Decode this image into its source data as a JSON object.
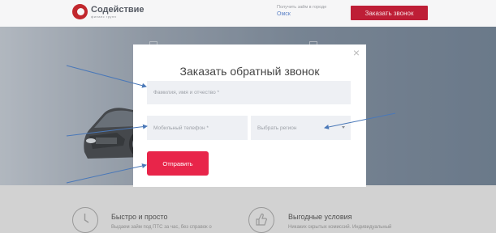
{
  "header": {
    "logo_name": "Содействие",
    "logo_sub": "финанс групп",
    "city_prompt": "Получить займ в городе",
    "city_name": "Омск",
    "callback_button": "Заказать звонок"
  },
  "features": [
    {
      "title": "Быстро и просто",
      "text": "Выдаем займ под ПТС за час, без справок о",
      "icon": "clock-icon"
    },
    {
      "title": "Выгодные условия",
      "text": "Никаких скрытых комиссий. Индивидуальный",
      "icon": "thumbs-up-icon"
    }
  ],
  "modal": {
    "title": "Заказать обратный звонок",
    "close_glyph": "×",
    "name_placeholder": "Фамилия, имя и отчество *",
    "phone_placeholder": "Мобильный телефон *",
    "region_placeholder": "Выбрать регион",
    "submit_label": "Отправить"
  },
  "colors": {
    "brand_red": "#be1e36",
    "submit_red": "#e8254a",
    "field_bg": "#eef0f4",
    "city_link": "#5b82c7",
    "annotation_arrow": "#4a78b8"
  }
}
